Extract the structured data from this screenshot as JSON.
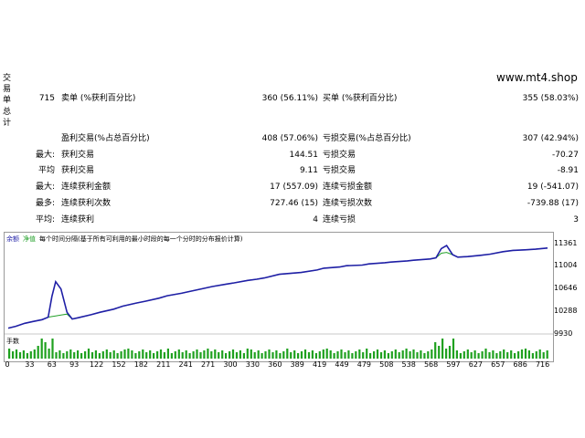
{
  "sidebar_label": "交易单总计",
  "site": "www.mt4.shop",
  "rows": [
    {
      "c1": "715",
      "l1": "卖单 (%获利百分比)",
      "v1": "360 (56.11%)",
      "l2": "买单 (%获利百分比)",
      "v2": "355 (58.03%)"
    },
    {
      "c1": "",
      "l1": "盈利交易(%占总百分比)",
      "v1": "408 (57.06%)",
      "l2": "亏损交易(%占总百分比)",
      "v2": "307 (42.94%)"
    },
    {
      "c1": "最大:",
      "l1": "获利交易",
      "v1": "144.51",
      "l2": "亏损交易",
      "v2": "-70.27"
    },
    {
      "c1": "平均",
      "l1": "获利交易",
      "v1": "9.11",
      "l2": "亏损交易",
      "v2": "-8.91"
    },
    {
      "c1": "最大:",
      "l1": "连续获利金额",
      "v1": "17 (557.09)",
      "l2": "连续亏损金额",
      "v2": "19 (-541.07)"
    },
    {
      "c1": "最多:",
      "l1": "连续获利次数",
      "v1": "727.46 (15)",
      "l2": "连续亏损次数",
      "v2": "-739.88 (17)"
    },
    {
      "c1": "平均:",
      "l1": "连续获利",
      "v1": "4",
      "l2": "连续亏损",
      "v2": "3"
    }
  ],
  "chart_legend": {
    "balance": "余额",
    "equity": "净值",
    "desc": "每个时间分隔(基于所有可利用的最小时段的每一个分时的分布报价计算)"
  },
  "volume_label": "手数",
  "colors": {
    "balance": "#1f1fa6",
    "equity": "#23a02a",
    "volume": "#1fa11f",
    "frame": "#9a9a9a"
  },
  "chart_data": {
    "type": "line",
    "x_ticks": [
      "0",
      "33",
      "63",
      "93",
      "122",
      "152",
      "182",
      "211",
      "241",
      "271",
      "300",
      "330",
      "360",
      "389",
      "419",
      "449",
      "479",
      "508",
      "538",
      "568",
      "597",
      "627",
      "657",
      "686",
      "716"
    ],
    "y_ticks": [
      "11361",
      "11004",
      "10646",
      "10288",
      "9930"
    ],
    "series": [
      {
        "name": "余额",
        "values": [
          [
            0,
            9980
          ],
          [
            10,
            10010
          ],
          [
            22,
            10060
          ],
          [
            33,
            10090
          ],
          [
            45,
            10120
          ],
          [
            53,
            10160
          ],
          [
            58,
            10500
          ],
          [
            63,
            10740
          ],
          [
            70,
            10620
          ],
          [
            78,
            10240
          ],
          [
            85,
            10130
          ],
          [
            93,
            10150
          ],
          [
            110,
            10200
          ],
          [
            122,
            10240
          ],
          [
            140,
            10290
          ],
          [
            152,
            10340
          ],
          [
            170,
            10390
          ],
          [
            182,
            10420
          ],
          [
            200,
            10470
          ],
          [
            211,
            10510
          ],
          [
            230,
            10550
          ],
          [
            241,
            10580
          ],
          [
            260,
            10630
          ],
          [
            271,
            10660
          ],
          [
            290,
            10700
          ],
          [
            300,
            10720
          ],
          [
            318,
            10760
          ],
          [
            330,
            10780
          ],
          [
            340,
            10800
          ],
          [
            360,
            10860
          ],
          [
            389,
            10890
          ],
          [
            410,
            10930
          ],
          [
            419,
            10960
          ],
          [
            440,
            10980
          ],
          [
            449,
            11000
          ],
          [
            470,
            11010
          ],
          [
            479,
            11030
          ],
          [
            500,
            11050
          ],
          [
            508,
            11060
          ],
          [
            530,
            11080
          ],
          [
            538,
            11090
          ],
          [
            560,
            11110
          ],
          [
            568,
            11130
          ],
          [
            575,
            11280
          ],
          [
            582,
            11330
          ],
          [
            590,
            11180
          ],
          [
            597,
            11140
          ],
          [
            610,
            11150
          ],
          [
            627,
            11170
          ],
          [
            640,
            11190
          ],
          [
            657,
            11230
          ],
          [
            670,
            11250
          ],
          [
            686,
            11260
          ],
          [
            700,
            11270
          ],
          [
            716,
            11290
          ]
        ]
      }
    ]
  }
}
